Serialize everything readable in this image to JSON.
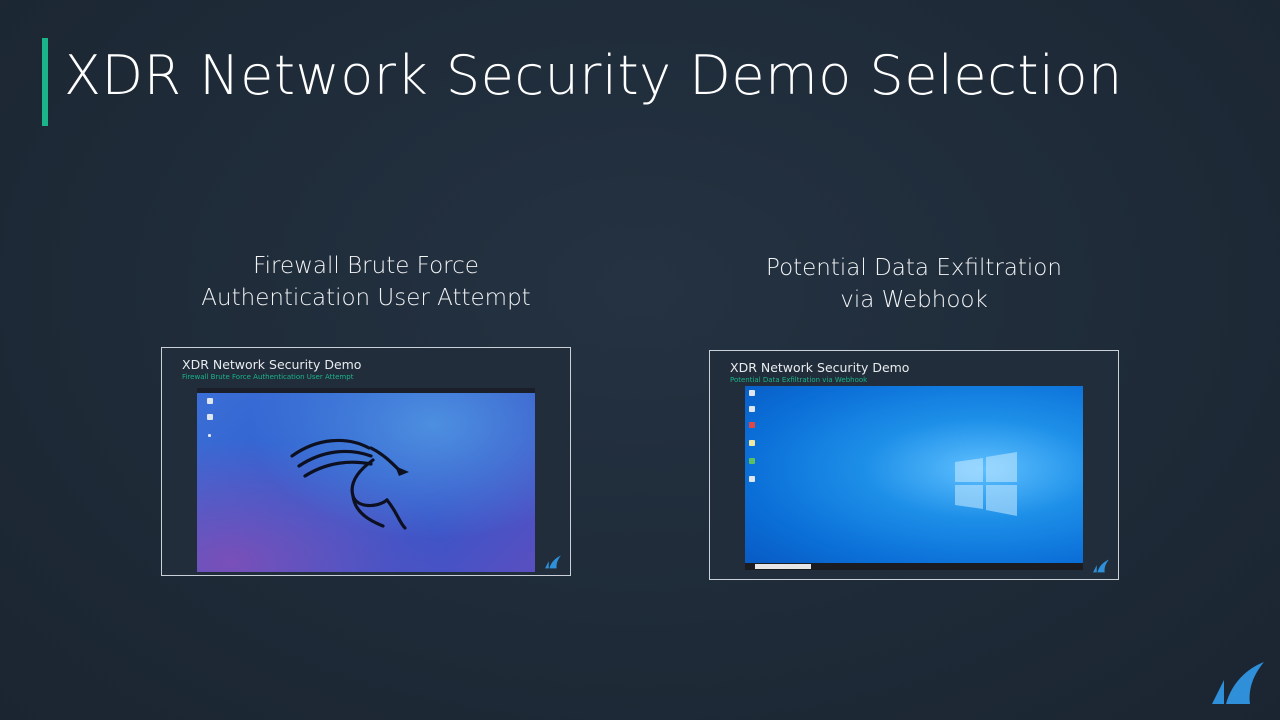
{
  "slide": {
    "title": "XDR Network Security Demo Selection",
    "accent_color": "#1bb38a",
    "background_color": "#1f2b38"
  },
  "options": [
    {
      "caption_line1": "Firewall Brute Force",
      "caption_line2": "Authentication User Attempt",
      "thumb_title": "XDR Network Security Demo",
      "thumb_subtitle": "Firewall Brute Force Authentication User Attempt",
      "desktop": "kali-linux-desktop"
    },
    {
      "caption_line1": "Potential Data Exfiltration",
      "caption_line2": "via Webhook",
      "thumb_title": "XDR Network Security Demo",
      "thumb_subtitle": "Potential Data Exfiltration via Webhook",
      "desktop": "windows-10-desktop"
    }
  ],
  "icons": {
    "brand_logo": "barracuda-fin-logo",
    "kali_logo": "kali-dragon-icon",
    "windows_logo": "windows-logo-icon"
  }
}
